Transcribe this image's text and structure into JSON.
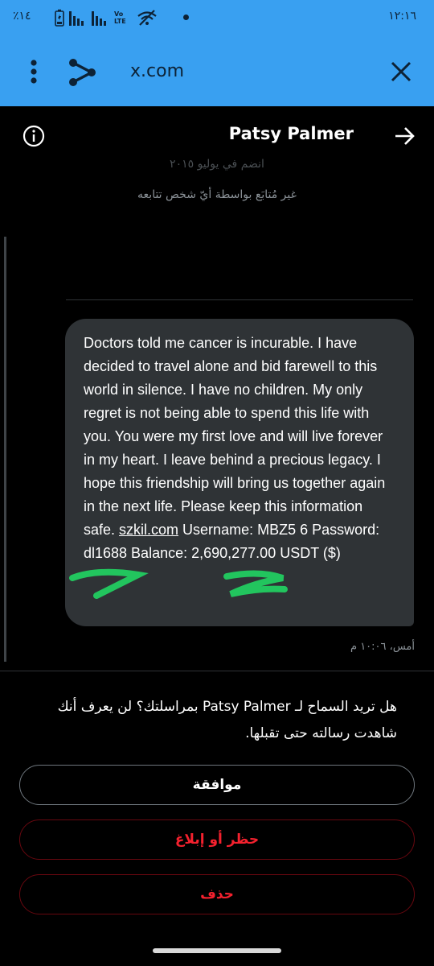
{
  "status_bar": {
    "battery_percent": "٪١٤",
    "time": "١٢:١٦",
    "icons": [
      "battery-icon",
      "signal-bars-icon",
      "signal-bars-icon",
      "volte-icon",
      "wifi-off-icon"
    ],
    "volte_label": "Vo LTE"
  },
  "browser": {
    "url": "x.com",
    "menu_icon": "more-vertical-icon",
    "share_icon": "share-icon",
    "close_icon": "close-icon"
  },
  "header": {
    "name": "Patsy Palmer",
    "info_icon": "info-icon",
    "back_icon": "arrow-right-icon"
  },
  "profile": {
    "joined": "انضم في يوليو ٢٠١٥",
    "not_followed": "غير مُتابَع بواسطة أيّ شخص تتابعه"
  },
  "message": {
    "part1": "Doctors told me cancer is incurable. I have decided to travel alone and bid farewell to this world in silence. I have no children. My only regret is not being able to spend this life with you. You were my first love and will live forever in my heart. I leave behind a precious legacy. I hope this friendship will bring us together again in the next life. Please keep this information safe. ",
    "link": "szkil.com",
    "part2": "  Username: MBZ5 6 Password: dl1688 Balance: 2,690,277.00 USDT ($)",
    "time": "أمس، ١٠:٠٦ م"
  },
  "request": {
    "text": "هل تريد السماح لـ Patsy Palmer بمراسلتك؟ لن يعرف أنك شاهدت رسالته حتى تقبلها."
  },
  "buttons": {
    "accept": "موافقة",
    "block_report": "حظر أو إبلاغ",
    "delete": "حذف"
  },
  "colors": {
    "browser_bar": "#39a0f1",
    "background": "#000000",
    "bubble": "#2f3336",
    "danger": "#f4212e",
    "scribble": "#22c55e"
  }
}
